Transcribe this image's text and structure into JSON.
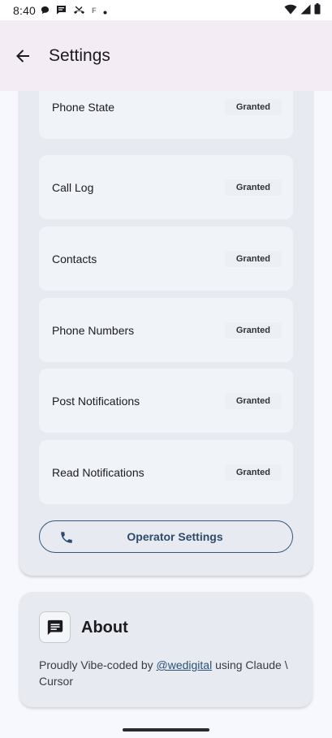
{
  "status_bar": {
    "time": "8:40",
    "left_icons": [
      "chat-bubble-icon",
      "message-icon",
      "missed-call-icon",
      "f-icon",
      "dot-icon"
    ],
    "right_icons": [
      "wifi-icon",
      "cell-signal-icon",
      "battery-icon"
    ]
  },
  "app_bar": {
    "title": "Settings",
    "back_icon": "arrow-left-icon"
  },
  "permissions": {
    "items": [
      {
        "label": "Phone State",
        "status": "Granted"
      },
      {
        "label": "Call Log",
        "status": "Granted"
      },
      {
        "label": "Contacts",
        "status": "Granted"
      },
      {
        "label": "Phone Numbers",
        "status": "Granted"
      },
      {
        "label": "Post Notifications",
        "status": "Granted"
      },
      {
        "label": "Read Notifications",
        "status": "Granted"
      }
    ],
    "operator_button": {
      "label": "Operator Settings",
      "icon": "phone-icon"
    }
  },
  "about": {
    "title": "About",
    "icon": "message-icon",
    "text_before": "Proudly Vibe-coded by ",
    "link": "@wedigital",
    "text_after": " using Claude \\ Cursor"
  },
  "colors": {
    "app_bar_bg": "#f3ecf4",
    "card_bg": "#e7ebf1",
    "item_bg": "#f0f3f8",
    "accent": "#2e4a6b"
  }
}
